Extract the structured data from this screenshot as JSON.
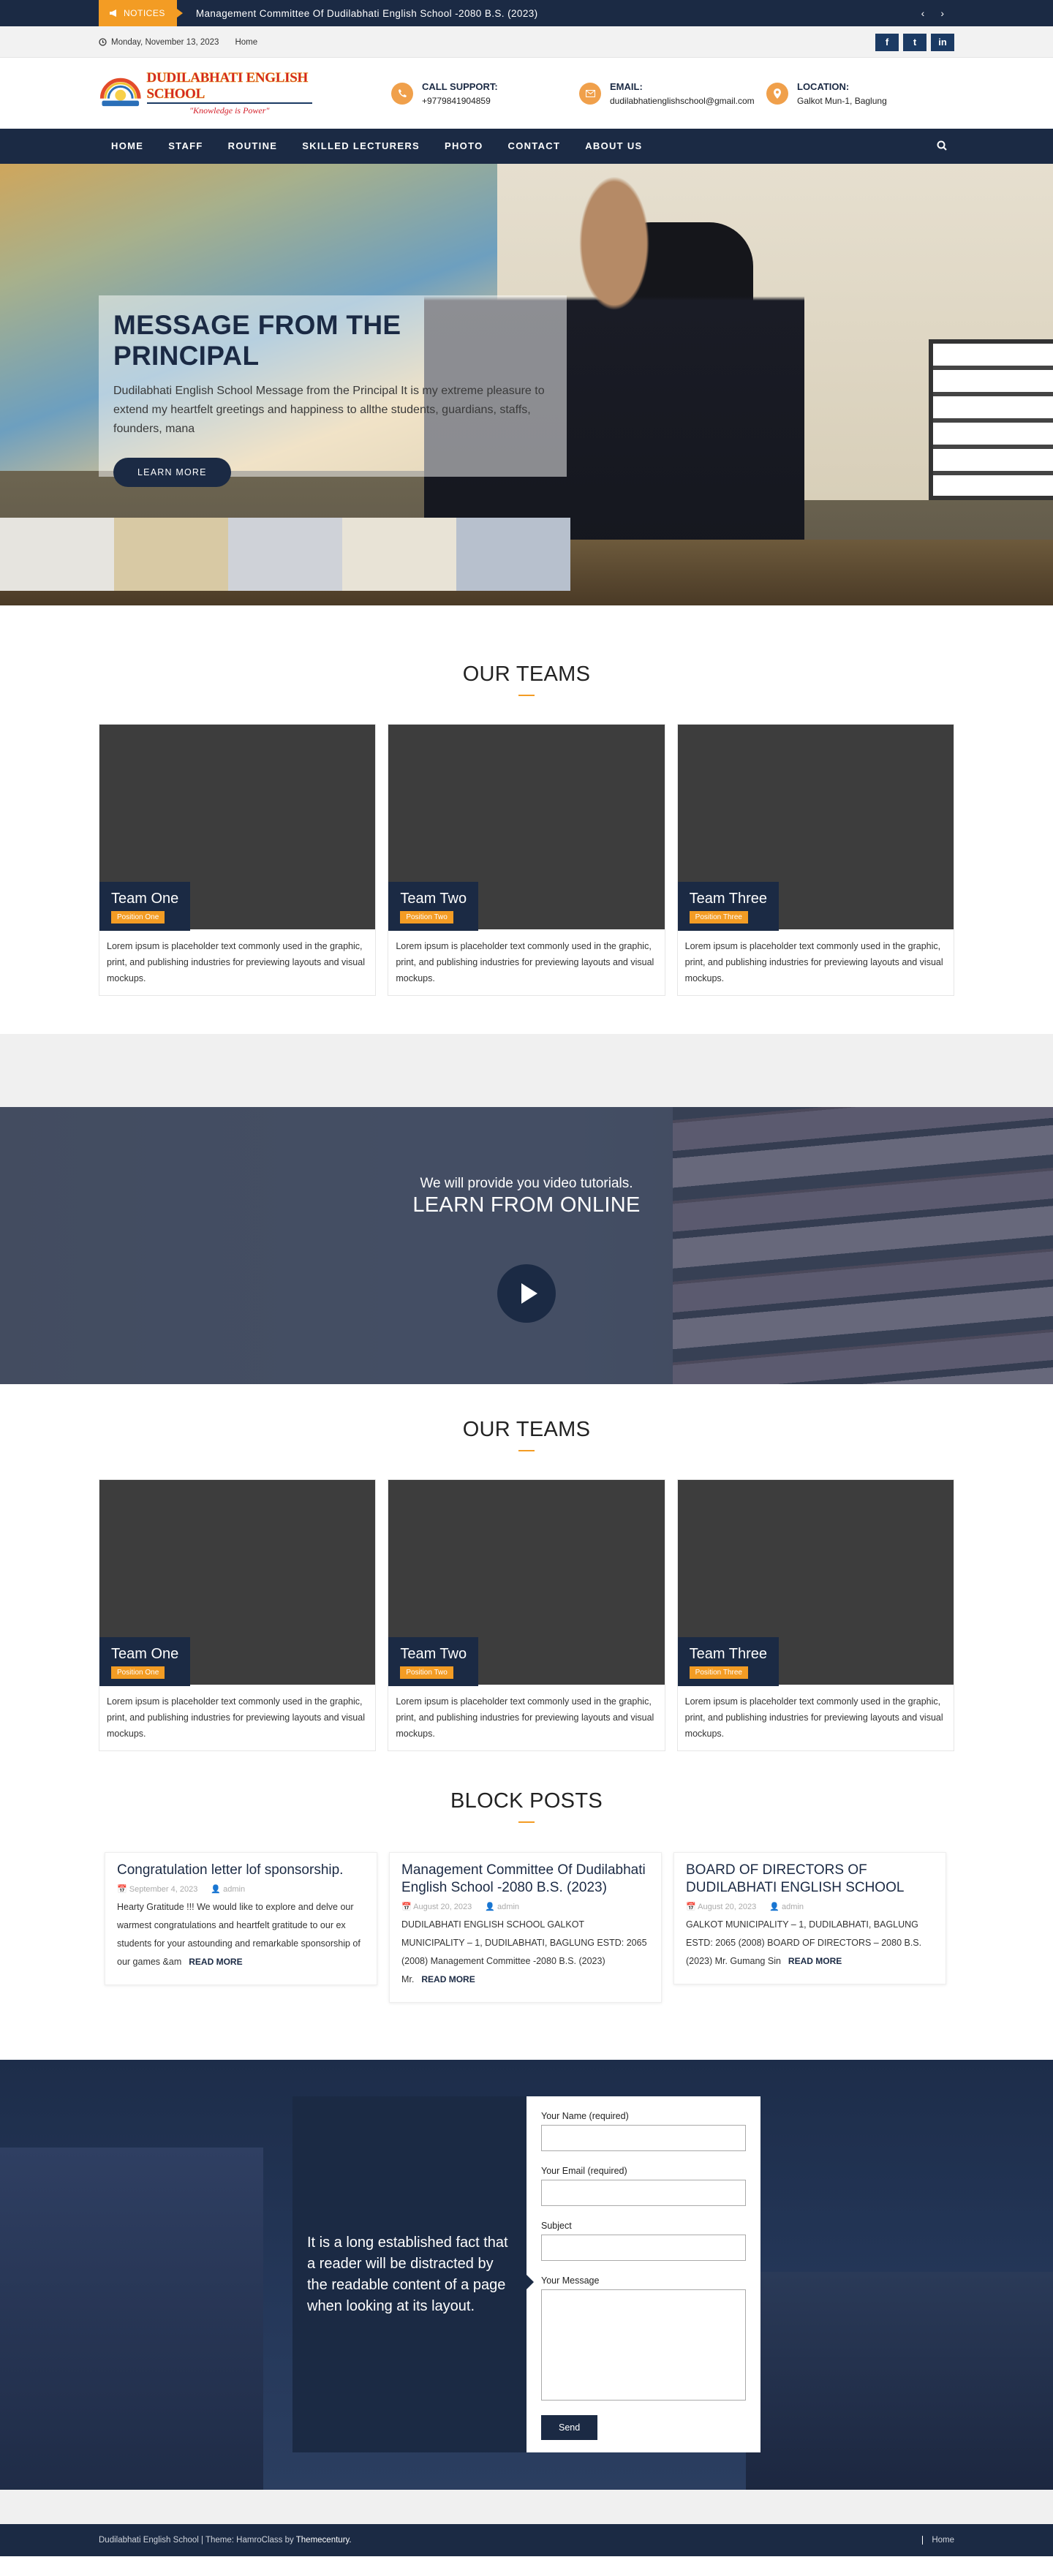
{
  "notice": {
    "label": "NOTICES",
    "text": "Management Committee Of Dudilabhati English School -2080 B.S. (2023)",
    "prev": "‹",
    "next": "›"
  },
  "topbar": {
    "date": "Monday, November 13, 2023",
    "home": "Home",
    "social": [
      "f",
      "t",
      "in"
    ]
  },
  "logo": {
    "name": "DUDILABHATI ENGLISH SCHOOL",
    "motto": "\"Knowledge is Power\""
  },
  "contact_info": [
    {
      "title": "CALL SUPPORT:",
      "value": "+9779841904859",
      "icon": "phone-icon"
    },
    {
      "title": "EMAIL:",
      "value": "dudilabhatienglishschool@gmail.com",
      "icon": "envelope-icon"
    },
    {
      "title": "LOCATION:",
      "value": "Galkot Mun-1, Baglung",
      "icon": "map-pin-icon"
    }
  ],
  "nav": [
    "HOME",
    "STAFF",
    "ROUTINE",
    "SKILLED LECTURERS",
    "PHOTO",
    "CONTACT",
    "ABOUT US"
  ],
  "hero": {
    "title": "MESSAGE FROM THE PRINCIPAL",
    "text": "Dudilabhati English School    Message from the Principal It is my extreme pleasure to extend my heartfelt greetings and happiness to allthe students, guardians, staffs, founders, mana",
    "button": "LEARN MORE"
  },
  "teams_title": "OUR TEAMS",
  "teams": [
    {
      "name": "Team One",
      "position": "Position One",
      "desc": "Lorem ipsum is placeholder text commonly used in the graphic, print, and publishing industries for previewing layouts and visual mockups."
    },
    {
      "name": "Team Two",
      "position": "Position Two",
      "desc": "Lorem ipsum is placeholder text commonly used in the graphic, print, and publishing industries for previewing layouts and visual mockups."
    },
    {
      "name": "Team Three",
      "position": "Position Three",
      "desc": "Lorem ipsum is placeholder text commonly used in the graphic, print, and publishing industries for previewing layouts and visual mockups."
    }
  ],
  "video": {
    "small": "We will provide you video tutorials.",
    "big": "LEARN FROM ONLINE"
  },
  "posts_title": "BLOCK POSTS",
  "posts": [
    {
      "title": "Congratulation letter lof sponsorship.",
      "date": "September 4, 2023",
      "author": "admin",
      "excerpt": "Hearty Gratitude !!! We would like to explore and delve our warmest congratulations and heartfelt gratitude to our ex students for your astounding and remarkable sponsorship of our games &am",
      "more": "READ MORE"
    },
    {
      "title": "Management Committee Of Dudilabhati English School -2080 B.S. (2023)",
      "date": "August 20, 2023",
      "author": "admin",
      "excerpt": "DUDILABHATI  ENGLISH SCHOOL        GALKOT MUNICIPALITY – 1, DUDILABHATI, BAGLUNG ESTD: 2065 (2008) Management Committee -2080 B.S. (2023) Mr.",
      "more": "READ MORE"
    },
    {
      "title": "BOARD OF DIRECTORS OF DUDILABHATI ENGLISH SCHOOL",
      "date": "August 20, 2023",
      "author": "admin",
      "excerpt": "GALKOT MUNICIPALITY – 1, DUDILABHATI, BAGLUNG ESTD: 2065 (2008) BOARD OF DIRECTORS – 2080 B.S. (2023) Mr. Gumang Sin",
      "more": "READ MORE"
    }
  ],
  "contact": {
    "quote": "It is a long established fact that a reader will be distracted by the readable content of a page when looking at its layout.",
    "labels": [
      "Your Name (required)",
      "Your Email (required)",
      "Subject",
      "Your Message"
    ],
    "send": "Send"
  },
  "footer": {
    "text": "Dudilabhati English School | Theme: HamroClass by ",
    "brand": "Themecentury.",
    "home": "Home"
  }
}
